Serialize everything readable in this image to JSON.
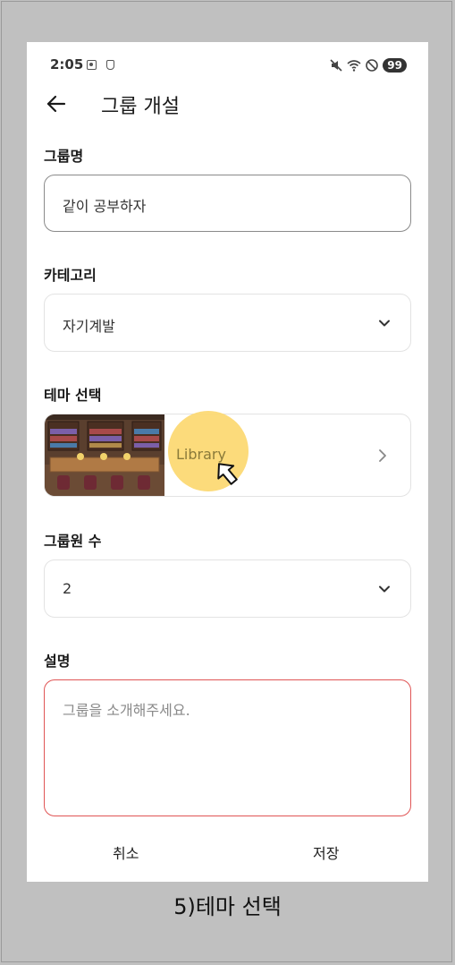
{
  "status_bar": {
    "time": "2:05",
    "battery": "99"
  },
  "app_bar": {
    "title": "그룹 개설"
  },
  "form": {
    "group_name": {
      "label": "그룹명",
      "value": "같이 공부하자"
    },
    "category": {
      "label": "카테고리",
      "selected": "자기계발"
    },
    "theme": {
      "label": "테마 선택",
      "selected": "Library"
    },
    "member_count": {
      "label": "그룹원 수",
      "selected": "2"
    },
    "description": {
      "label": "설명",
      "placeholder": "그룹을 소개해주세요."
    }
  },
  "actions": {
    "cancel": "취소",
    "save": "저장"
  },
  "caption": "5)테마 선택",
  "colors": {
    "highlight": "#fcd974",
    "error_border": "#e05555",
    "field_border": "#e3e3e3"
  }
}
